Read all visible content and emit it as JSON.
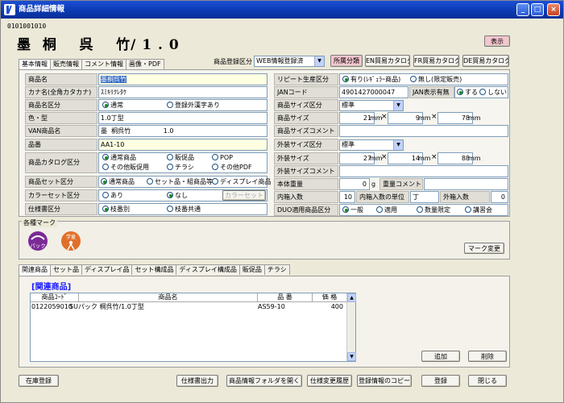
{
  "window": {
    "title": "商品詳細情報"
  },
  "header": {
    "code": "0101001010",
    "product_name_display": "墨  桐    呉    竹/ 1 . 0",
    "show_button": "表示"
  },
  "main_tabs": [
    "基本情報",
    "販売情報",
    "コメント情報",
    "画像・PDF"
  ],
  "registration": {
    "label": "商品登録区分",
    "value": "WEB情報登録済"
  },
  "category_buttons": [
    "所属分類",
    "EN貿易カタログ",
    "FR貿易カタログ",
    "DE貿易カタログ"
  ],
  "left_form": {
    "product_name": {
      "label": "商品名",
      "value": "墨桐呉竹"
    },
    "kana_name": {
      "label": "カナ名(全角カタカナ)",
      "value": "ｽﾐｷﾘｸﾚﾀｹ"
    },
    "name_type": {
      "label": "商品名区分",
      "options": [
        "通常",
        "登録外漢字あり"
      ],
      "selected": 0
    },
    "color_type": {
      "label": "色・型",
      "value": "1.0丁型"
    },
    "van_name": {
      "label": "VAN商品名",
      "value": "墨  桐呉竹                1.0"
    },
    "part_no": {
      "label": "品番",
      "value": "AA1-10"
    },
    "catalog_type": {
      "label": "商品カタログ区分",
      "options": [
        "通常商品",
        "販促品",
        "POP",
        "その他販促用",
        "チラシ",
        "その他PDF"
      ],
      "selected": 0
    },
    "set_type": {
      "label": "商品セット区分",
      "options": [
        "通常商品",
        "セット品・組商品等",
        "ディスプレイ商品"
      ],
      "selected": 0
    },
    "color_set": {
      "label": "カラーセット区分",
      "options": [
        "あり",
        "なし"
      ],
      "selected": 1,
      "button": "カラーセット"
    },
    "spec_type": {
      "label": "仕様書区分",
      "options": [
        "枝番別",
        "枝番共通"
      ],
      "selected": 0
    }
  },
  "right_form": {
    "repeat": {
      "label": "リピート生産区分",
      "options": [
        "有り(ﾚｷﾞｭﾗｰ商品)",
        "無し(限定販売)"
      ],
      "selected": 0
    },
    "jan": {
      "label": "JANコード",
      "value": "4901427000047",
      "show_label": "JAN表示有無",
      "options": [
        "する",
        "しない"
      ],
      "selected": 0
    },
    "size_type": {
      "label": "商品サイズ区分",
      "value": "標準"
    },
    "size": {
      "label": "商品サイズ",
      "values": [
        "21",
        "9",
        "78"
      ],
      "unit": "mm",
      "times": "×"
    },
    "size_comment": {
      "label": "商品サイズコメント",
      "value": ""
    },
    "box_size_type": {
      "label": "外装サイズ区分",
      "value": "標準"
    },
    "box_size": {
      "label": "外装サイズ",
      "values": [
        "27",
        "14",
        "88"
      ],
      "unit": "mm"
    },
    "box_comment": {
      "label": "外装サイズコメント",
      "value": ""
    },
    "weight": {
      "label": "本体重量",
      "value": "0",
      "unit": "g",
      "comment_label": "重量コメント",
      "comment": ""
    },
    "inner": {
      "label": "内箱入数",
      "value": "10",
      "unit_label": "内箱入数の単位",
      "unit_value": "丁",
      "outer_label": "外箱入数",
      "outer_value": "0"
    },
    "duo": {
      "label": "DUO適用商品区分",
      "options": [
        "一般",
        "適用",
        "数量限定",
        "講習会"
      ],
      "selected": 0
    }
  },
  "marks": {
    "title": "各種マーク",
    "icons": [
      {
        "icon": "pack-mark-icon",
        "text": "パック"
      },
      {
        "icon": "gakuyou-mark-icon",
        "text": "学童"
      }
    ],
    "change_button": "マーク変更"
  },
  "related_tabs": [
    "関連商品",
    "セット品",
    "ディスプレイ品",
    "セット構成品",
    "ディスプレイ構成品",
    "販促品",
    "チラシ"
  ],
  "related": {
    "heading": "[関連商品]",
    "columns": [
      "商品ｺｰﾄﾞ",
      "商品名",
      "品  番",
      "価  格"
    ],
    "rows": [
      {
        "code": "0122059010",
        "name": "SUパック  桐呉竹/1.0丁型",
        "part": "AS59-10",
        "price": "400"
      }
    ],
    "add_button": "追加",
    "delete_button": "削除"
  },
  "footer_buttons": [
    "在庫登録",
    "仕様書出力",
    "商品情報フォルダを開く",
    "仕様変更履歴",
    "登録情報のコピー",
    "登録",
    "閉じる"
  ],
  "colors": {
    "titlebar": "#0b3ab3",
    "pink_button": "#f5c6cf",
    "related_heading": "#1a1aff"
  }
}
